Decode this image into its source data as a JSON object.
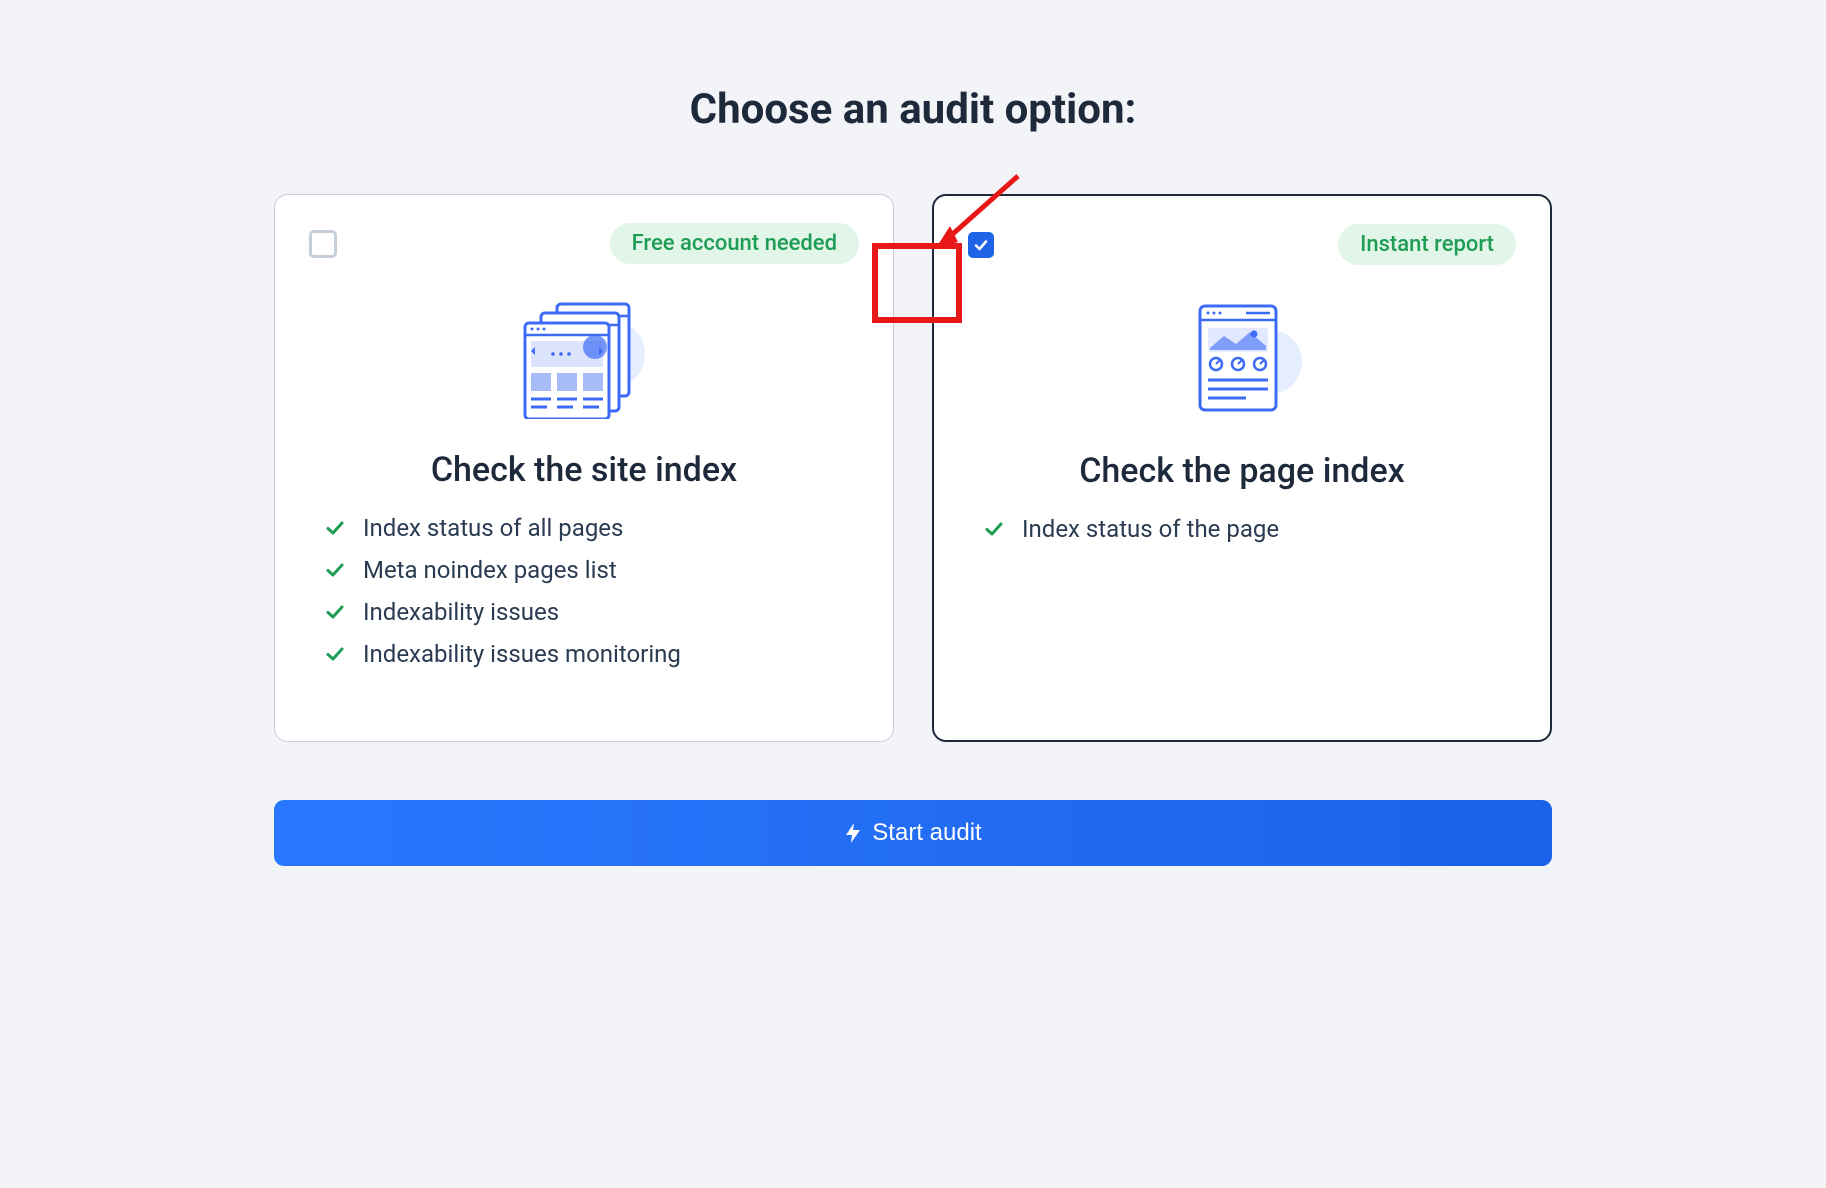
{
  "heading": "Choose an audit option:",
  "cards": {
    "site": {
      "badge": "Free account needed",
      "title": "Check the site index",
      "features": [
        "Index status of all pages",
        "Meta noindex pages list",
        "Indexability issues",
        "Indexability issues monitoring"
      ],
      "selected": false
    },
    "page": {
      "badge": "Instant report",
      "title": "Check the page index",
      "features": [
        "Index status of the page"
      ],
      "selected": true
    }
  },
  "button": {
    "label": "Start audit"
  },
  "colors": {
    "accent": "#1f63e6",
    "success": "#1f9d55",
    "text_dark": "#1e2a3b",
    "highlight": "#e81818",
    "badge_bg": "#e1f5e9"
  }
}
